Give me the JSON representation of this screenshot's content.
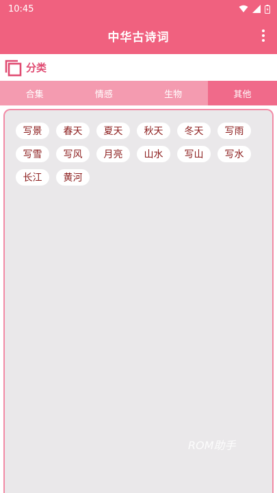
{
  "status_bar": {
    "time": "10:45"
  },
  "app_bar": {
    "title": "中华古诗词"
  },
  "section": {
    "title": "分类"
  },
  "tabs": [
    {
      "label": "合集"
    },
    {
      "label": "情感"
    },
    {
      "label": "生物"
    },
    {
      "label": "其他"
    }
  ],
  "active_tab": "其他",
  "tags": [
    "写景",
    "春天",
    "夏天",
    "秋天",
    "冬天",
    "写雨",
    "写雪",
    "写风",
    "月亮",
    "山水",
    "写山",
    "写水",
    "长江",
    "黄河"
  ],
  "watermark": "ROM助手",
  "colors": {
    "primary": "#f0617f",
    "tab_bg": "#f49bb0",
    "accent": "#e04b72",
    "tag_text": "#8b1b1b"
  }
}
